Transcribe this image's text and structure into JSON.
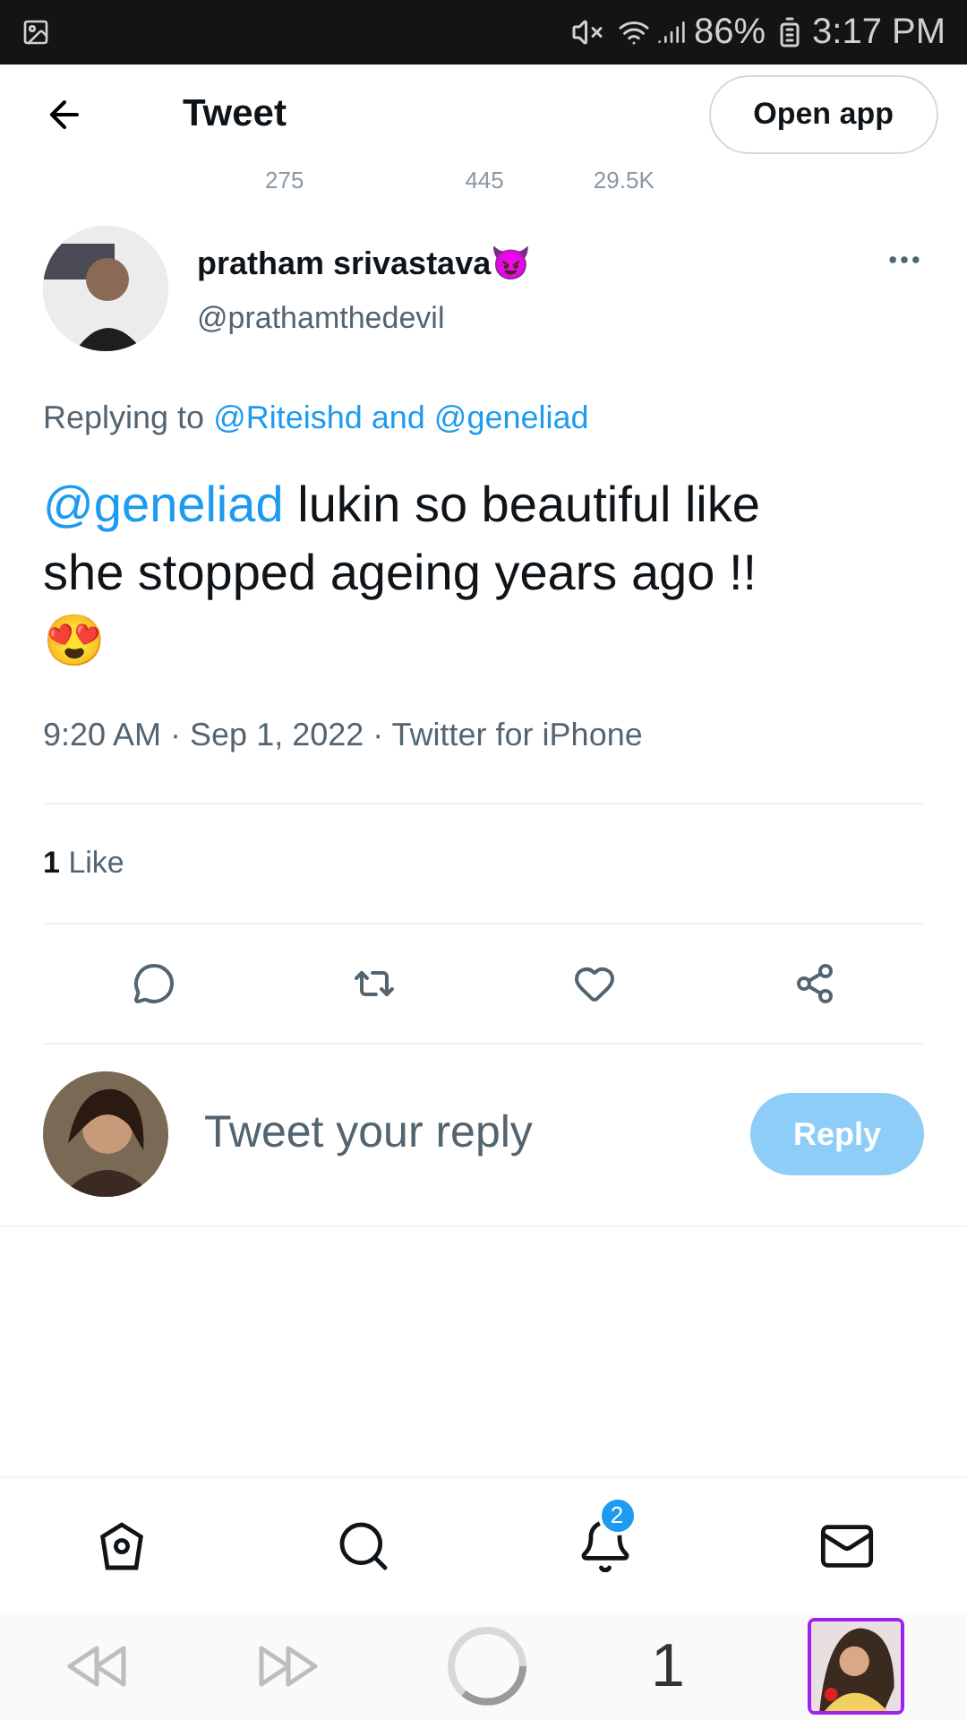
{
  "status_bar": {
    "battery": "86%",
    "time": "3:17 PM"
  },
  "background_stats": [
    "275",
    "445",
    "29.5K"
  ],
  "header": {
    "title": "Tweet",
    "open_app": "Open app"
  },
  "tweet": {
    "name": "pratham srivastava😈",
    "handle": "@prathamthedevil",
    "replying_label": "Replying to",
    "replying_to": "@Riteishd and @geneliad",
    "mention": "@geneliad",
    "text": " lukin so beautiful like she stopped ageing years ago !!",
    "emoji": "😍",
    "meta": "9:20 AM · Sep 1, 2022 · Twitter for iPhone",
    "likes_count": "1",
    "likes_label": "Like"
  },
  "reply": {
    "placeholder": "Tweet your reply",
    "button": "Reply",
    "disabled": true
  },
  "bottom_nav": {
    "notifications_badge": "2"
  },
  "browser_bar": {
    "tab_count": "1"
  }
}
